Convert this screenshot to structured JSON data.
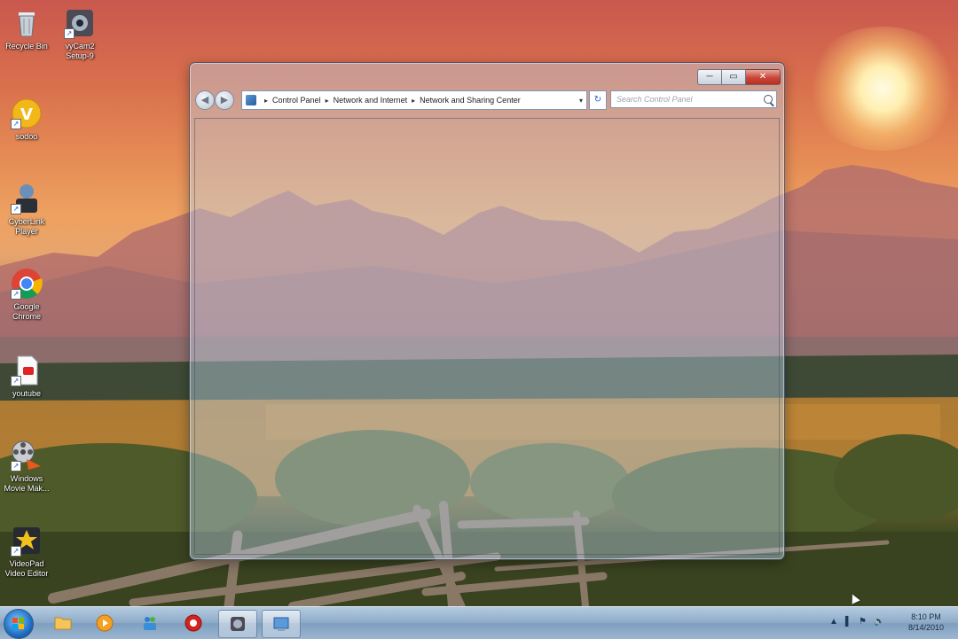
{
  "desktop": {
    "icons": [
      {
        "label": "Recycle Bin"
      },
      {
        "label": "vyCam2\nSetup-9"
      },
      {
        "label": "sodoo"
      },
      {
        "label": "CyberLink\nPlayer"
      },
      {
        "label": "Google\nChrome"
      },
      {
        "label": "youtube"
      },
      {
        "label": "Windows\nMovie Mak..."
      },
      {
        "label": "VideoPad\nVideo Editor"
      }
    ]
  },
  "window": {
    "controls": {
      "minimize": "─",
      "maximize": "▭",
      "close": "✕"
    },
    "nav": {
      "back": "◀",
      "forward": "▶"
    },
    "address": {
      "crumbs": [
        "Control Panel",
        "Network and Internet",
        "Network and Sharing Center"
      ],
      "separator": "▸",
      "dropdown": "▾"
    },
    "refresh": "↻",
    "search": {
      "placeholder": "Search Control Panel"
    }
  },
  "taskbar": {
    "tray": {
      "chevron": "▲",
      "network": "▌",
      "flag": "⚑",
      "volume": "🔈"
    },
    "clock": {
      "time": "8:10 PM",
      "date": "8/14/2010"
    }
  },
  "colors": {
    "accent": "#2a62b8",
    "close": "#c9473a"
  }
}
